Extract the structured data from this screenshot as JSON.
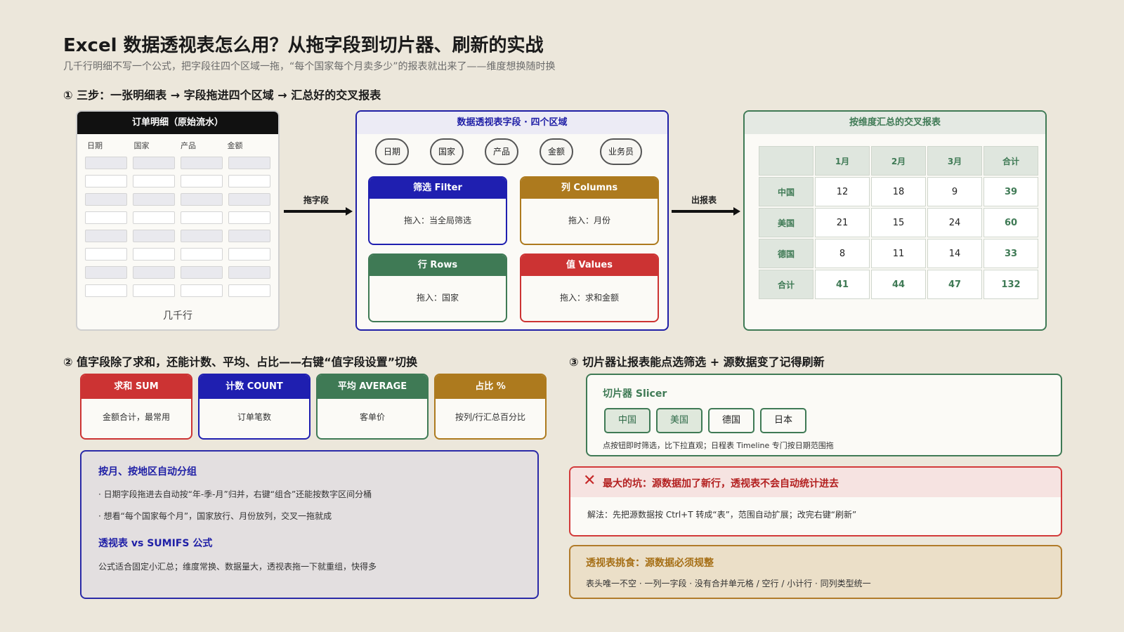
{
  "title": "Excel 数据透视表怎么用？从拖字段到切片器、刷新的实战",
  "subtitle": "几千行明细不写一个公式，把字段往四个区域一拖，“每个国家每个月卖多少”的报表就出来了——维度想换随时换",
  "section1": {
    "heading": "① 三步：一张明细表 → 字段拖进四个区域 → 汇总好的交叉报表",
    "orders": {
      "title": "订单明细（原始流水）",
      "columns": [
        "日期",
        "国家",
        "产品",
        "金额"
      ],
      "footer": "几千行"
    },
    "arrow1": "拖字段",
    "arrow2": "出报表",
    "fields": {
      "title": "数据透视表字段 · 四个区域",
      "pills": [
        "日期",
        "国家",
        "产品",
        "金额",
        "业务员"
      ],
      "zones": [
        {
          "title": "筛选 Filter",
          "body": "拖入：当全局筛选",
          "color": "#1f1fb0"
        },
        {
          "title": "列 Columns",
          "body": "拖入：月份",
          "color": "#ad7a1e"
        },
        {
          "title": "行 Rows",
          "body": "拖入：国家",
          "color": "#3f7a55"
        },
        {
          "title": "值 Values",
          "body": "拖入：求和金额",
          "color": "#cc3333"
        }
      ]
    },
    "report": {
      "title": "按维度汇总的交叉报表",
      "header": [
        "",
        "1月",
        "2月",
        "3月",
        "合计"
      ],
      "rows": [
        [
          "中国",
          "12",
          "18",
          "9",
          "39"
        ],
        [
          "美国",
          "21",
          "15",
          "24",
          "60"
        ],
        [
          "德国",
          "8",
          "11",
          "14",
          "33"
        ],
        [
          "合计",
          "41",
          "44",
          "47",
          "132"
        ]
      ]
    }
  },
  "section2": {
    "heading": "② 值字段除了求和，还能计数、平均、占比——右键“值字段设置”切换",
    "cards": [
      {
        "title": "求和 SUM",
        "body": "金额合计，最常用",
        "color": "#cc3333"
      },
      {
        "title": "计数 COUNT",
        "body": "订单笔数",
        "color": "#1f1fb0"
      },
      {
        "title": "平均 AVERAGE",
        "body": "客单价",
        "color": "#3f7a55"
      },
      {
        "title": "占比 %",
        "body": "按列/行汇总百分比",
        "color": "#ad7a1e"
      }
    ],
    "group": {
      "title1": "按月、按地区自动分组",
      "bullet1": "· 日期字段拖进去自动按“年-季-月”归并，右键“组合”还能按数字区间分桶",
      "bullet2": "· 想看“每个国家每个月”，国家放行、月份放列，交叉一拖就成",
      "title2": "透视表 vs SUMIFS 公式",
      "text2": "公式适合固定小汇总；维度常换、数据量大，透视表拖一下就重组，快得多"
    }
  },
  "section3": {
    "heading": "③ 切片器让报表能点选筛选 + 源数据变了记得刷新",
    "slicer": {
      "title": "切片器 Slicer",
      "buttons": [
        "中国",
        "美国",
        "德国",
        "日本"
      ],
      "note": "点按钮即时筛选，比下拉直观；日程表 Timeline 专门按日期范围拖"
    },
    "pit": {
      "icon": "✕",
      "title": "最大的坑：源数据加了新行，透视表不会自动统计进去",
      "body": "解法：先把源数据按 Ctrl+T 转成“表”，范围自动扩展；改完右键“刷新”"
    },
    "picky": {
      "title": "透视表挑食：源数据必须规整",
      "body": "表头唯一不空 · 一列一字段 · 没有合并单元格 / 空行 / 小计行 · 同列类型统一"
    }
  }
}
